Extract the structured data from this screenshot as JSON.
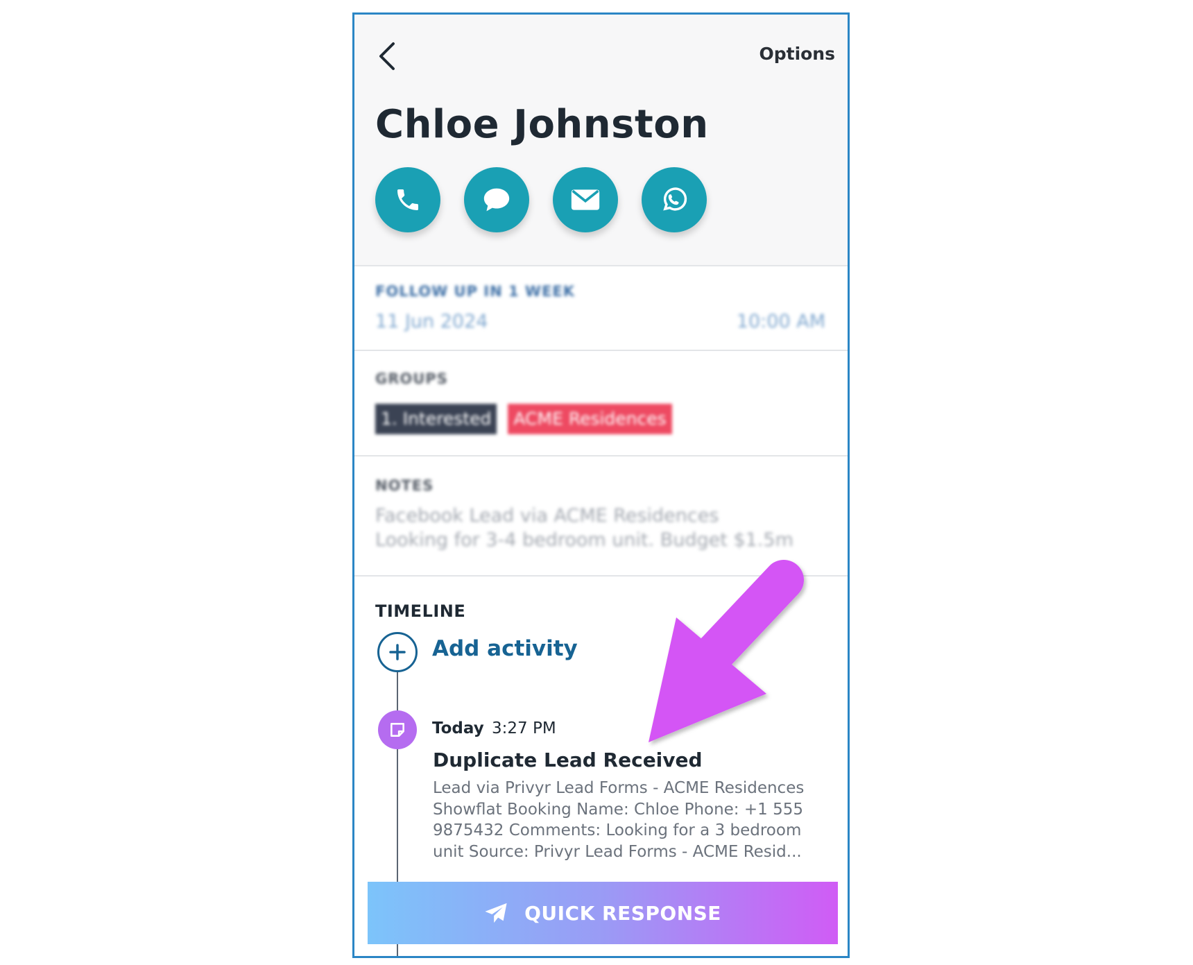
{
  "header": {
    "back_icon": "chevron-left-icon",
    "options_label": "Options",
    "contact_name": "Chloe Johnston",
    "actions": [
      {
        "icon": "phone-icon"
      },
      {
        "icon": "chat-bubble-icon"
      },
      {
        "icon": "mail-icon"
      },
      {
        "icon": "whatsapp-icon"
      }
    ]
  },
  "follow_up": {
    "label": "FOLLOW UP IN 1 WEEK",
    "date": "11 Jun 2024",
    "time": "10:00 AM"
  },
  "groups": {
    "label": "GROUPS",
    "tags": [
      "1. Interested",
      "ACME Residences"
    ]
  },
  "notes": {
    "label": "NOTES",
    "lines": [
      "Facebook Lead via ACME Residences",
      "Looking for 3-4 bedroom unit. Budget $1.5m"
    ]
  },
  "timeline": {
    "label": "TIMELINE",
    "add_activity_label": "Add activity",
    "entries": [
      {
        "day": "Today",
        "time": "3:27 PM",
        "title": "Duplicate Lead Received",
        "description": "Lead via Privyr Lead Forms - ACME Residences Showflat Booking  Name: Chloe Phone: +1 555 9875432 Comments: Looking for a 3 bedroom unit  Source: Privyr Lead Forms - ACME Resid..."
      }
    ]
  },
  "quick_response": {
    "label": "QUICK RESPONSE",
    "icon": "paper-plane-icon"
  },
  "colors": {
    "action_teal": "#1aa0b4",
    "frame_blue": "#2b86c5",
    "link_blue": "#176393",
    "note_purple": "#b56cf0",
    "annotation_magenta": "#d455f5",
    "tag_dark": "#3b4354",
    "tag_red": "#ee4a62"
  }
}
